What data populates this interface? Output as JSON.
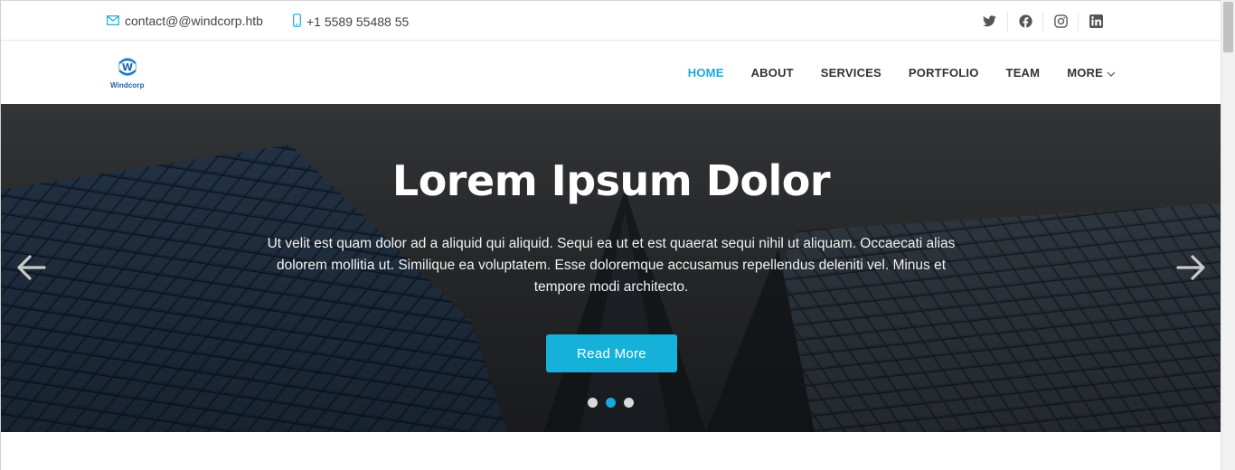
{
  "topbar": {
    "email": "contact@@windcorp.htb",
    "phone": "+1 5589 55488 55",
    "social": [
      "twitter-icon",
      "facebook-icon",
      "instagram-icon",
      "linkedin-icon"
    ]
  },
  "header": {
    "logo_text": "Windcorp",
    "nav": [
      {
        "label": "HOME",
        "active": true
      },
      {
        "label": "ABOUT"
      },
      {
        "label": "SERVICES"
      },
      {
        "label": "PORTFOLIO"
      },
      {
        "label": "TEAM"
      },
      {
        "label": "MORE"
      }
    ]
  },
  "hero": {
    "title": "Lorem Ipsum Dolor",
    "text": "Ut velit est quam dolor ad a aliquid qui aliquid. Sequi ea ut et est quaerat sequi nihil ut aliquam. Occaecati alias dolorem mollitia ut. Similique ea voluptatem. Esse doloremque accusamus repellendus deleniti vel. Minus et tempore modi architecto.",
    "button": "Read More",
    "slides": 3,
    "active_slide": 2
  },
  "colors": {
    "accent": "#16aad8",
    "button": "#16b1d9",
    "hero_overlay": "#3f4449"
  }
}
